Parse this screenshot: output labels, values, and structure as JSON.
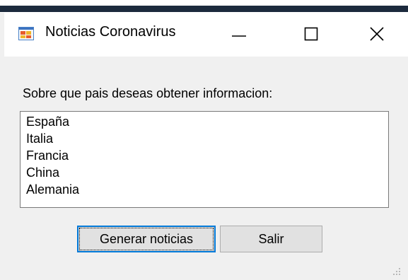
{
  "window": {
    "title": "Noticias Coronavirus"
  },
  "form": {
    "prompt": "Sobre que pais deseas obtener informacion:",
    "countries": [
      "España",
      "Italia",
      "Francia",
      "China",
      "Alemania"
    ]
  },
  "buttons": {
    "generate_label": "Generar noticias",
    "exit_label": "Salir"
  },
  "icons": {
    "app": "form-app-icon",
    "minimize": "minimize-icon",
    "maximize": "maximize-icon",
    "close": "close-icon",
    "resize": "resize-grip-icon"
  },
  "colors": {
    "focus_border": "#0078d7",
    "button_face": "#e1e1e1",
    "window_bg": "#f0f0f0"
  }
}
